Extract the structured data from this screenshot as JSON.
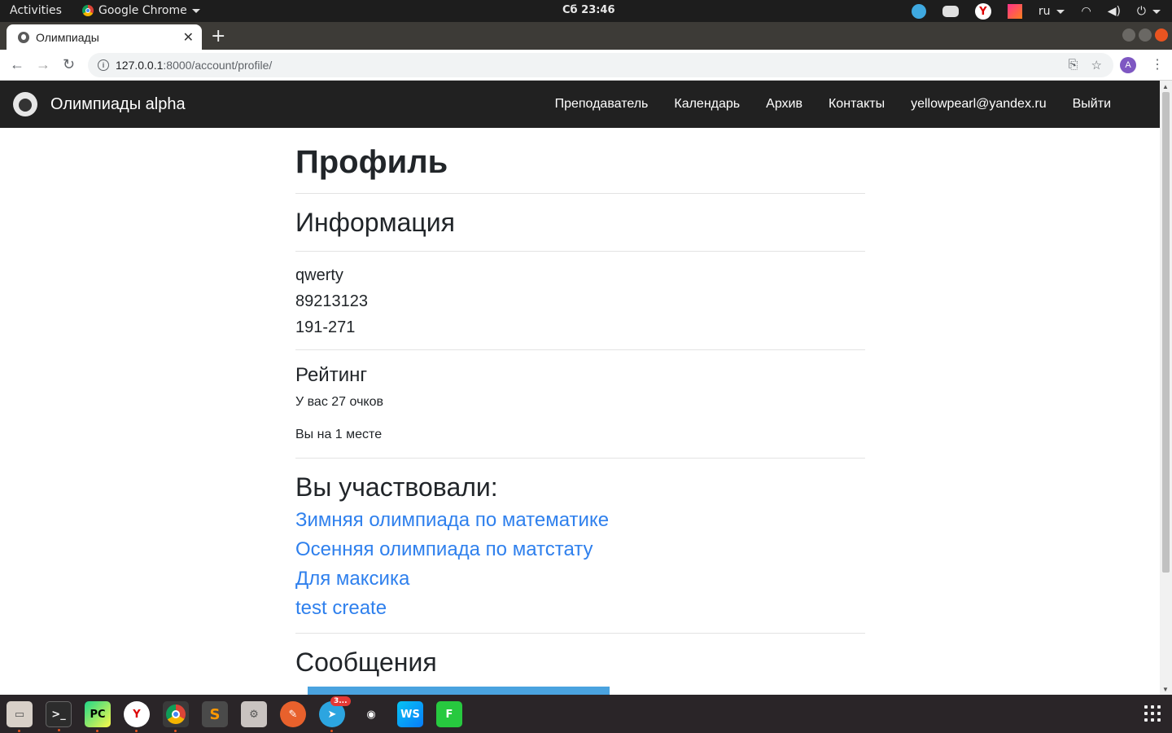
{
  "system_bar": {
    "activities": "Activities",
    "app_name": "Google Chrome",
    "clock": "Сб 23:46",
    "language": "ru"
  },
  "browser": {
    "tab_title": "Олимпиады",
    "url_host": "127.0.0.1",
    "url_path": ":8000/account/profile/",
    "profile_initial": "A"
  },
  "site": {
    "brand": "Олимпиады alpha",
    "nav": [
      "Преподаватель",
      "Календарь",
      "Архив",
      "Контакты",
      "yellowpearl@yandex.ru",
      "Выйти"
    ]
  },
  "profile": {
    "title": "Профиль",
    "info_heading": "Информация",
    "username": "qwerty",
    "phone": "89213123",
    "group": "191-271",
    "rating_heading": "Рейтинг",
    "points_text": "У вас 27 очков",
    "place_text": "Вы на 1 месте",
    "participated_heading": "Вы участвовали:",
    "olympiads": [
      "Зимняя олимпиада по математике",
      "Осенняя олимпиада по матстату",
      "Для максика",
      "test create"
    ],
    "messages_heading": "Сообщения"
  },
  "taskbar": {
    "telegram_badge": "3..."
  },
  "colors": {
    "navbar": "#212121",
    "link": "#2f80ed",
    "message_bar": "#4aa3df",
    "accent": "#e95420"
  }
}
